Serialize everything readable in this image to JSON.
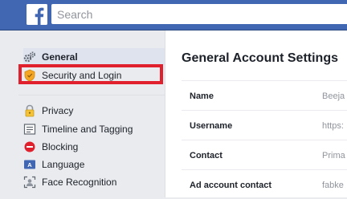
{
  "header": {
    "logo_letter": "f",
    "brand_color": "#4267b2",
    "search_placeholder": "Search"
  },
  "sidebar": {
    "items": [
      {
        "label": "General",
        "icon": "gears-icon",
        "active": true
      },
      {
        "label": "Security and Login",
        "icon": "shield-icon",
        "highlighted": true
      },
      {
        "label": "Privacy",
        "icon": "padlock-icon"
      },
      {
        "label": "Timeline and Tagging",
        "icon": "timeline-icon"
      },
      {
        "label": "Blocking",
        "icon": "block-icon"
      },
      {
        "label": "Language",
        "icon": "language-icon"
      },
      {
        "label": "Face Recognition",
        "icon": "face-recognition-icon"
      }
    ],
    "highlight_color": "#e0202c"
  },
  "main": {
    "title": "General Account Settings",
    "rows": [
      {
        "label": "Name",
        "value": "Beeja"
      },
      {
        "label": "Username",
        "value": "https:"
      },
      {
        "label": "Contact",
        "value": "Prima"
      },
      {
        "label": "Ad account contact",
        "value": "fabke"
      }
    ]
  }
}
